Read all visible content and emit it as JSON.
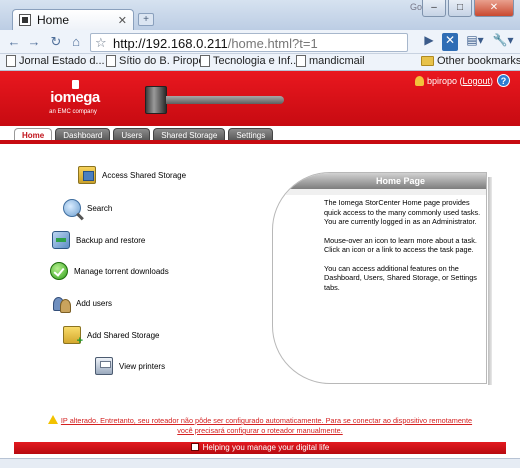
{
  "browser": {
    "tab_title": "Home",
    "tab_close": "✕",
    "new_tab": "+",
    "window_label": "Google",
    "url_host": "http://192.168.0.211",
    "url_path": "/home.html?t=1",
    "bookmarks": [
      "Jornal Estado d...",
      "Sítio do B. Piropo",
      "Tecnologia e Inf...",
      "mandicmail"
    ],
    "other_bookmarks": "Other bookmarks",
    "icons": [
      "back-icon",
      "forward-icon",
      "reload-icon",
      "home-icon",
      "star-icon",
      "page-icon",
      "wrench-icon"
    ]
  },
  "header": {
    "logo_name": "iomega",
    "logo_sub": "an EMC company",
    "user": "bpiropo",
    "logout": "Logout",
    "help": "?"
  },
  "nav": {
    "tabs": [
      "Home",
      "Dashboard",
      "Users",
      "Shared Storage",
      "Settings"
    ],
    "active": "Home"
  },
  "tasks": [
    {
      "label": "Access Shared Storage",
      "icon": "shared-storage-icon"
    },
    {
      "label": "Search",
      "icon": "search-icon"
    },
    {
      "label": "Backup and restore",
      "icon": "backup-icon"
    },
    {
      "label": "Manage torrent downloads",
      "icon": "torrent-icon"
    },
    {
      "label": "Add users",
      "icon": "users-icon"
    },
    {
      "label": "Add Shared Storage",
      "icon": "add-shared-storage-icon"
    },
    {
      "label": "View printers",
      "icon": "printer-icon"
    }
  ],
  "home_panel": {
    "title": "Home Page",
    "paragraphs": [
      "The Iomega StorCenter Home page provides quick access to the many commonly used tasks. You are currently logged in as an Administrator.",
      "Mouse-over an icon to learn more about a task. Click an icon or a link to access the task page.",
      "You can access additional features on the Dashboard, Users, Shared Storage, or Settings tabs."
    ]
  },
  "warning": {
    "line1": "IP alterado. Entretanto, seu roteador não pôde ser configurado automaticamente. Para se conectar ao dispositivo remotamente",
    "line2": "você precisará configurar o roteador manualmente."
  },
  "footer": {
    "text": "Helping you manage your digital life"
  },
  "colors": {
    "brand_red": "#c70a11",
    "warning_red": "#d42020"
  }
}
